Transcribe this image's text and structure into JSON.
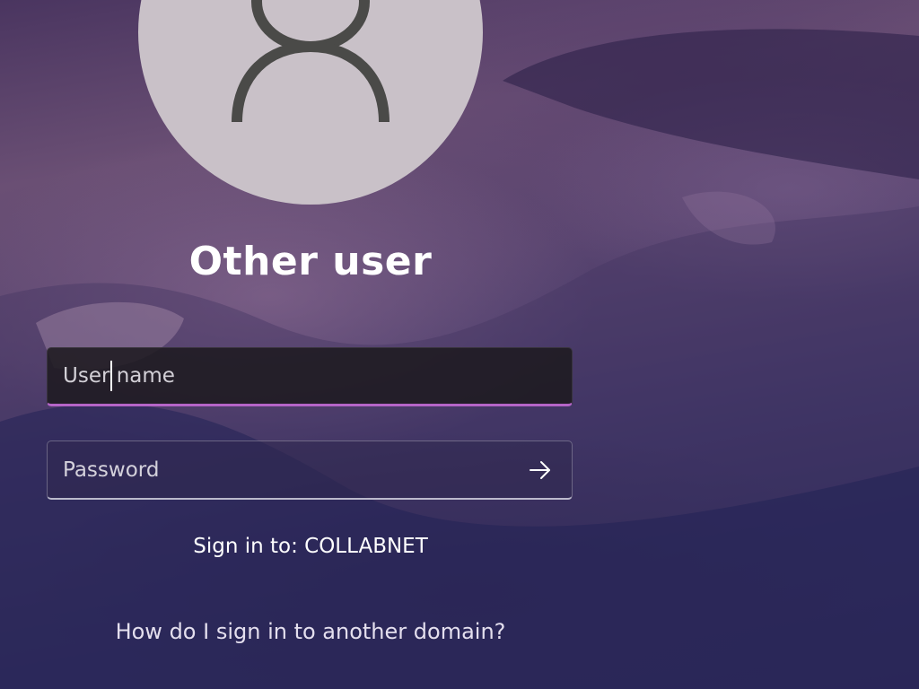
{
  "user": {
    "display_name": "Other user",
    "avatar_icon": "person-icon"
  },
  "form": {
    "username_placeholder": "User name",
    "username_value": "",
    "password_placeholder": "Password",
    "password_value": "",
    "submit_icon": "arrow-right-icon"
  },
  "signin_target": {
    "text": "Sign in to: COLLABNET"
  },
  "help_link": {
    "text": "How do I sign in to another domain?"
  },
  "colors": {
    "accent": "#b565c7",
    "avatar_bg": "#c9c1c8",
    "avatar_glyph": "#4a4a48",
    "text": "#ffffff"
  }
}
